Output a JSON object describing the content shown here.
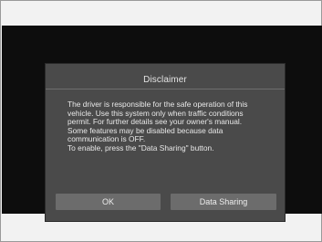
{
  "dialog": {
    "title": "Disclaimer",
    "body": "The driver is responsible for the safe operation of this\nvehicle. Use this system only when traffic conditions\npermit. For further details see your owner's manual.\nSome features may be disabled because data\ncommunication is OFF.\nTo enable, press the \"Data Sharing\" button.",
    "ok_label": "OK",
    "data_sharing_label": "Data Sharing"
  }
}
